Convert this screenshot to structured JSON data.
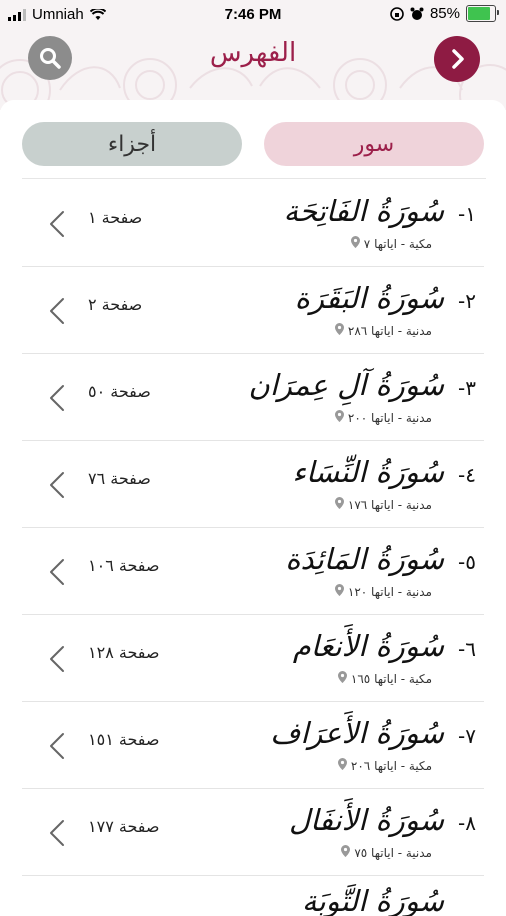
{
  "status_bar": {
    "carrier": "Umniah",
    "time": "7:46 PM",
    "battery": "85%",
    "battery_level": 0.85
  },
  "nav": {
    "title": "الفهرس",
    "search_icon": "search-icon",
    "next_icon": "chevron-right-icon"
  },
  "tabs": {
    "ajza": "أجزاء",
    "suwar": "سور",
    "selected": "suwar"
  },
  "colors": {
    "accent": "#8e1b43",
    "selected_tab_bg": "#efd3da",
    "unselected_tab_bg": "#c8d0ce"
  },
  "surahs": [
    {
      "number": "١-",
      "name": "سُورَةُ الفَاتِحَة",
      "meta": "مكية - اياتها ٧",
      "page": "صفحة ١"
    },
    {
      "number": "٢-",
      "name": "سُورَةُ البَقَرَة",
      "meta": "مدنية - اياتها ٢٨٦",
      "page": "صفحة ٢"
    },
    {
      "number": "٣-",
      "name": "سُورَةُ آلِ عِمرَان",
      "meta": "مدنية - اياتها ٢٠٠",
      "page": "صفحة ٥٠"
    },
    {
      "number": "٤-",
      "name": "سُورَةُ النِّسَاء",
      "meta": "مدنية - اياتها ١٧٦",
      "page": "صفحة ٧٦"
    },
    {
      "number": "٥-",
      "name": "سُورَةُ المَائِدَة",
      "meta": "مدنية - اياتها ١٢٠",
      "page": "صفحة ١٠٦"
    },
    {
      "number": "٦-",
      "name": "سُورَةُ الأَنعَام",
      "meta": "مكية - اياتها ١٦٥",
      "page": "صفحة ١٢٨"
    },
    {
      "number": "٧-",
      "name": "سُورَةُ الأَعرَاف",
      "meta": "مكية - اياتها ٢٠٦",
      "page": "صفحة ١٥١"
    },
    {
      "number": "٨-",
      "name": "سُورَةُ الأَنفَال",
      "meta": "مدنية - اياتها ٧٥",
      "page": "صفحة ١٧٧"
    }
  ],
  "peek_row": {
    "name": "سُورَةُ التَّوبَة"
  }
}
